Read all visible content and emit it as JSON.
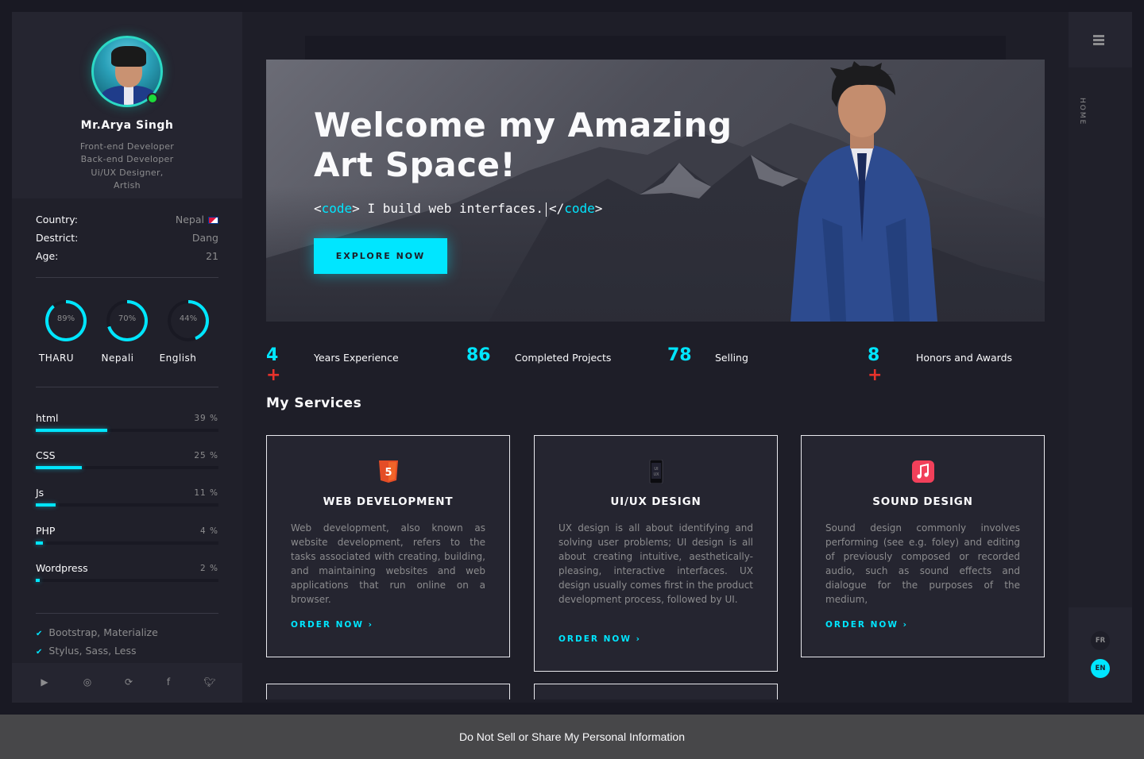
{
  "profile": {
    "name": "Mr.Arya Singh",
    "roles": [
      "Front-end Developer",
      "Back-end Developer",
      "Ui/UX Designer,",
      "Artish"
    ]
  },
  "info": [
    {
      "key": "Country:",
      "value": "Nepal"
    },
    {
      "key": "Destrict:",
      "value": "Dang"
    },
    {
      "key": "Age:",
      "value": "21"
    }
  ],
  "languages": [
    {
      "label": "89%",
      "name": "THARU",
      "value": 89
    },
    {
      "label": "70%",
      "name": "Nepali",
      "value": 70
    },
    {
      "label": "44%",
      "name": "English",
      "value": 44
    }
  ],
  "skills": [
    {
      "name": "html",
      "pct_label": "39 %",
      "value": 39
    },
    {
      "name": "CSS",
      "pct_label": "25 %",
      "value": 25
    },
    {
      "name": "Js",
      "pct_label": "11 %",
      "value": 11
    },
    {
      "name": "PHP",
      "pct_label": "4 %",
      "value": 4
    },
    {
      "name": "Wordpress",
      "pct_label": "2 %",
      "value": 2
    }
  ],
  "tools": [
    "Bootstrap, Materialize",
    "Stylus, Sass, Less"
  ],
  "social_icons": [
    "youtube-icon",
    "instagram-icon",
    "refresh-icon",
    "facebook-icon",
    "twitter-icon"
  ],
  "hero": {
    "title_line1": "Welcome my Amazing",
    "title_line2": "Art Space!",
    "code_open_lt": "<",
    "code_tag": "code",
    "code_open_gt": ">",
    "code_text": " I build web interfaces.",
    "code_close_lt": "</",
    "code_close_gt": ">",
    "button": "EXPLORE NOW"
  },
  "stats": [
    {
      "num": "4",
      "plus": "+",
      "label": "Years Experience"
    },
    {
      "num": "86",
      "plus": "",
      "label": "Completed Projects"
    },
    {
      "num": "78",
      "plus": "",
      "label": "Selling"
    },
    {
      "num": "8",
      "plus": "+",
      "label": "Honors and Awards"
    }
  ],
  "services": {
    "title": "My Services",
    "cards": [
      {
        "icon": "html5-icon",
        "title": "WEB DEVELOPMENT",
        "text": "Web development, also known as website development, refers to the tasks associated with creating, building, and maintaining websites and web applications that run online on a browser.",
        "link": "ORDER NOW ›"
      },
      {
        "icon": "phone-icon",
        "title": "UI/UX DESIGN",
        "text": "UX design is all about identifying and solving user problems; UI design is all about creating intuitive, aesthetically-pleasing, interactive interfaces. UX design usually comes first in the product development process, followed by UI.",
        "link": "ORDER NOW ›"
      },
      {
        "icon": "music-icon",
        "title": "SOUND DESIGN",
        "text": "Sound design commonly involves performing (see e.g. foley) and editing of previously composed or recorded audio, such as sound effects and dialogue for the purposes of the medium,",
        "link": "ORDER NOW ›"
      }
    ]
  },
  "rnav": {
    "home": "HOME",
    "lang_fr": "FR",
    "lang_en": "EN"
  },
  "footer": {
    "privacy": "Do Not Sell or Share My Personal Information"
  },
  "colors": {
    "accent": "#00e6ff",
    "bg": "#1e1e28",
    "panel": "#252530",
    "plus": "#e8322b"
  }
}
